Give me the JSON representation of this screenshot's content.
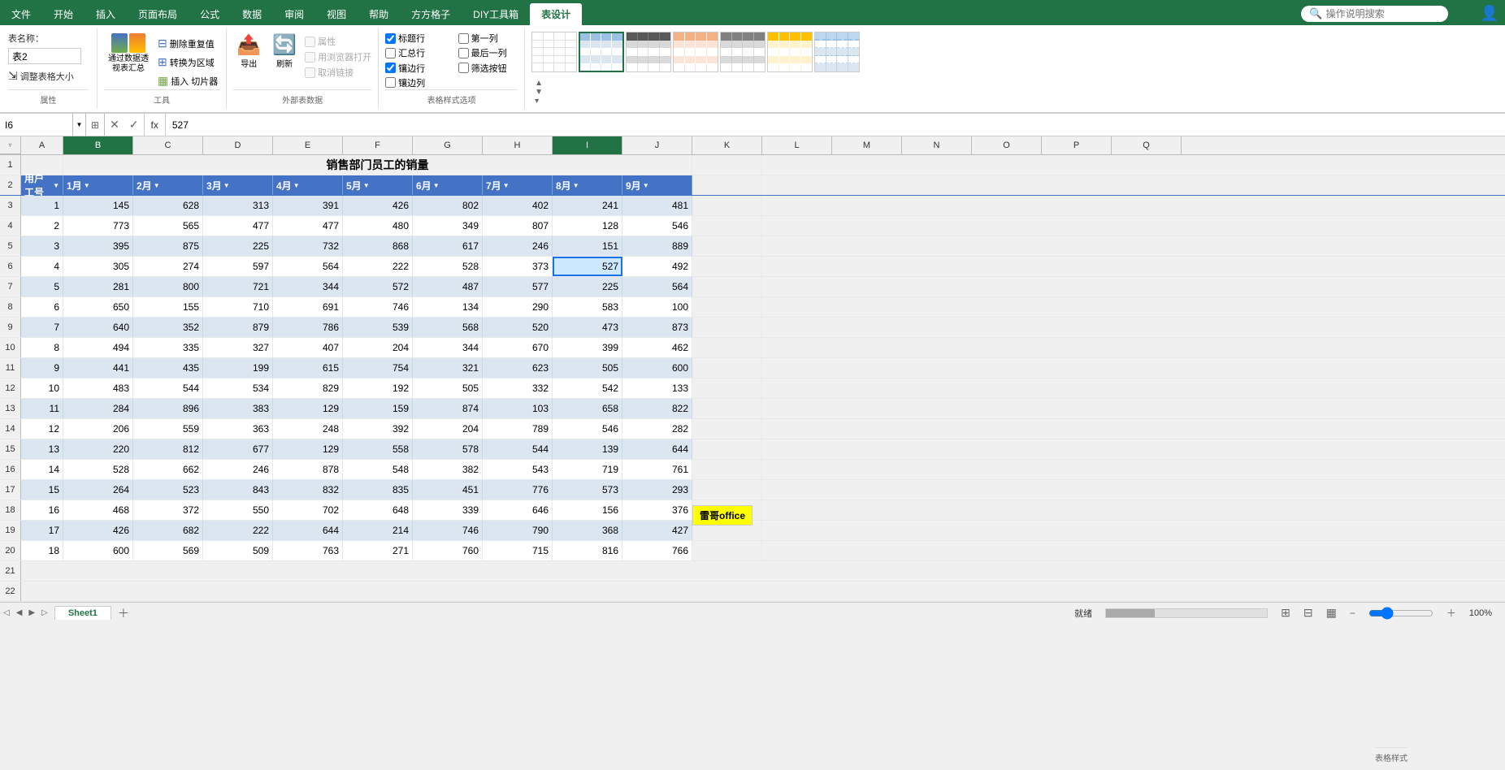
{
  "app": {
    "title": "表设计",
    "tabs": [
      "文件",
      "开始",
      "插入",
      "页面布局",
      "公式",
      "数据",
      "审阅",
      "视图",
      "帮助",
      "方方格子",
      "DIY工具箱",
      "表设计"
    ],
    "active_tab": "表设计",
    "search_placeholder": "操作说明搜索"
  },
  "ribbon": {
    "groups": {
      "properties": {
        "label": "属性",
        "table_name_label": "表名称：",
        "table_name_value": "表2",
        "resize_label": "调整表格大小"
      },
      "tools": {
        "label": "工具",
        "btn1": "通过数据透视表汇总",
        "btn2": "删除重复值",
        "btn3": "转换为区域",
        "btn4": "插入\n切片器"
      },
      "external": {
        "label": "外部表数据",
        "btn1": "导出",
        "btn2": "刷新",
        "chk1": "属性",
        "chk2": "用浏览器打开",
        "chk3": "取消链接"
      },
      "style_options": {
        "label": "表格样式选项",
        "chk_title": "标题行",
        "chk_first_col": "第一列",
        "chk_filter": "筛选按钮",
        "chk_total": "汇总行",
        "chk_last_col": "最后一列",
        "chk_banded_rows": "镶边行",
        "chk_banded_cols": "镶边列"
      },
      "table_styles": {
        "label": "表格样式"
      }
    }
  },
  "formula_bar": {
    "name_box": "I6",
    "formula": "527"
  },
  "sheet": {
    "title": "销售部门员工的销量",
    "selected_cell": "I6",
    "headers": [
      "用户工号",
      "1月",
      "2月",
      "3月",
      "4月",
      "5月",
      "6月",
      "7月",
      "8月",
      "9月"
    ],
    "col_letters": [
      "A",
      "B",
      "C",
      "D",
      "E",
      "F",
      "G",
      "H",
      "I",
      "J",
      "K",
      "L",
      "M",
      "N",
      "O",
      "P",
      "Q"
    ],
    "rows": [
      [
        1,
        145,
        628,
        313,
        391,
        426,
        802,
        402,
        241,
        481
      ],
      [
        2,
        773,
        565,
        477,
        477,
        480,
        349,
        807,
        128,
        546
      ],
      [
        3,
        395,
        875,
        225,
        732,
        868,
        617,
        246,
        151,
        889
      ],
      [
        4,
        305,
        274,
        597,
        564,
        222,
        528,
        373,
        527,
        492
      ],
      [
        5,
        281,
        800,
        721,
        344,
        572,
        487,
        577,
        225,
        564
      ],
      [
        6,
        650,
        155,
        710,
        691,
        746,
        134,
        290,
        583,
        100
      ],
      [
        7,
        640,
        352,
        879,
        786,
        539,
        568,
        520,
        473,
        873
      ],
      [
        8,
        494,
        335,
        327,
        407,
        204,
        344,
        670,
        399,
        462
      ],
      [
        9,
        441,
        435,
        199,
        615,
        754,
        321,
        623,
        505,
        600
      ],
      [
        10,
        483,
        544,
        534,
        829,
        192,
        505,
        332,
        542,
        133
      ],
      [
        11,
        284,
        896,
        383,
        129,
        159,
        874,
        103,
        658,
        822
      ],
      [
        12,
        206,
        559,
        363,
        248,
        392,
        204,
        789,
        546,
        282
      ],
      [
        13,
        220,
        812,
        677,
        129,
        558,
        578,
        544,
        139,
        644
      ],
      [
        14,
        528,
        662,
        246,
        878,
        548,
        382,
        543,
        719,
        761
      ],
      [
        15,
        264,
        523,
        843,
        832,
        835,
        451,
        776,
        573,
        293
      ],
      [
        16,
        468,
        372,
        550,
        702,
        648,
        339,
        646,
        156,
        376
      ],
      [
        17,
        426,
        682,
        222,
        644,
        214,
        746,
        790,
        368,
        427
      ],
      [
        18,
        600,
        569,
        509,
        763,
        271,
        760,
        715,
        816,
        766
      ]
    ],
    "note": {
      "text": "雷哥office",
      "col": "K",
      "row": 19
    }
  },
  "sheet_tabs": [
    "Sheet1"
  ],
  "status": {
    "text": "就绪"
  }
}
